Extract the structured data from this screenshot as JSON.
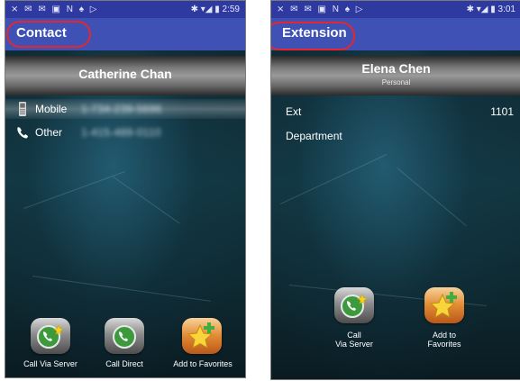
{
  "left": {
    "status_icons_left": "⨯ ✉ ✉ ▣ N ♠ ▷",
    "status_icons_right": "✱ ▾◢ ▮",
    "clock": "2:59",
    "title": "Contact",
    "contact_name": "Catherine Chan",
    "rows": [
      {
        "label": "Mobile",
        "value": "1-734-239-5696",
        "icon": "mobile-phone-icon"
      },
      {
        "label": "Other",
        "value": "1-415-489-0110",
        "icon": "phone-handset-icon"
      }
    ],
    "actions": [
      {
        "label": "Call Via Server",
        "icon": "call-via-server-icon"
      },
      {
        "label": "Call Direct",
        "icon": "call-direct-icon"
      },
      {
        "label": "Add to Favorites",
        "icon": "add-favorite-star-icon"
      }
    ]
  },
  "right": {
    "status_icons_left": "⨯ ✉ ✉ ▣ N ♠ ▷",
    "status_icons_right": "✱ ▾◢ ▮",
    "clock": "3:01",
    "title": "Extension",
    "contact_name": "Elena Chen",
    "contact_type": "Personal",
    "rows": [
      {
        "label": "Ext",
        "value": "1101"
      },
      {
        "label": "Department",
        "value": ""
      }
    ],
    "actions": [
      {
        "label_line1": "Call",
        "label_line2": "Via Server",
        "icon": "call-via-server-icon"
      },
      {
        "label_line1": "Add to",
        "label_line2": "Favorites",
        "icon": "add-favorite-star-icon"
      }
    ]
  },
  "colors": {
    "statusbar": "#2e3aa0",
    "appbar": "#3f51b5",
    "callout": "#e5262d"
  }
}
